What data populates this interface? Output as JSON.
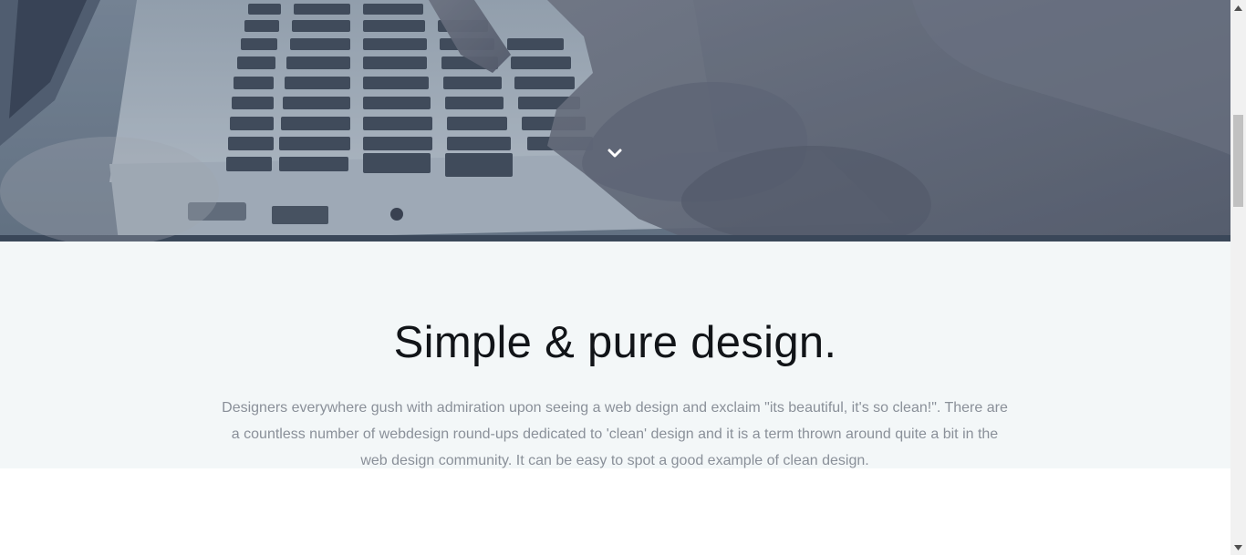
{
  "hero": {
    "scroll_down_icon": "chevron-down-icon"
  },
  "intro": {
    "heading": "Simple & pure design.",
    "body": "Designers everywhere gush with admiration upon seeing a web design and exclaim \"its beautiful, it's so clean!\". There are a countless number of webdesign round-ups dedicated to 'clean' design and it is a term thrown around quite a bit in the web design community. It can be easy to spot a good example of clean design."
  },
  "colors": {
    "intro_background": "#f3f7f8",
    "heading_text": "#111418",
    "body_text": "#8a9099"
  },
  "scrollbar": {
    "up_icon": "scroll-up-arrow-icon",
    "down_icon": "scroll-down-arrow-icon"
  }
}
